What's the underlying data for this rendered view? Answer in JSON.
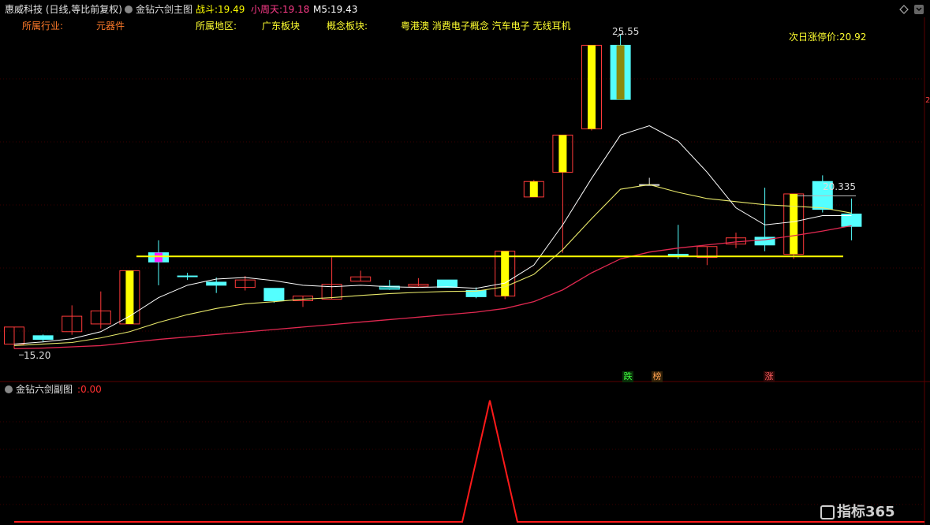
{
  "header": {
    "title": "惠威科技 (日线,等比前复权)",
    "indicator_name": "金钻六剑主图",
    "zhandou_label": "战斗:",
    "zhandou_value": "19.49",
    "xiaozhoutian_label": "小周天:",
    "xiaozhoutian_value": "19.18",
    "m5_label": "M5:",
    "m5_value": "19.43"
  },
  "info": {
    "industry_label": "所属行业:",
    "industry_value": "元器件",
    "region_label": "所属地区:",
    "region_value": "广东板块",
    "concept_label": "概念板块:",
    "concept_value": "粤港澳 消费电子概念 汽车电子 无线耳机",
    "limit_label": "次日涨停价:",
    "limit_value": "20.92"
  },
  "price_labels": {
    "high": "25.55",
    "low": "15.20",
    "right": "20.335",
    "edge_mark": "2"
  },
  "badges": {
    "down": "跌",
    "list": "榜",
    "up": "涨"
  },
  "sub_chart": {
    "title": "金钻六剑副图",
    "value_prefix": ":",
    "value": "0.00"
  },
  "watermark": {
    "brand": "指标365"
  },
  "colors": {
    "up_candle": "#ff3a3a",
    "down_candle": "#54ffff",
    "yellow": "#ffff00",
    "ma_white": "#ffffff",
    "ma_yellow": "#e8e86a",
    "ma_red": "#e02850",
    "sub_line": "#ff1a1a"
  },
  "chart_data": {
    "type": "candlestick",
    "candles": [
      {
        "o": 15.55,
        "c": 16.1,
        "h": 16.1,
        "l": 15.4,
        "style": "up"
      },
      {
        "o": 15.82,
        "c": 15.7,
        "h": 15.86,
        "l": 15.62,
        "style": "down"
      },
      {
        "o": 15.95,
        "c": 16.45,
        "h": 16.8,
        "l": 15.85,
        "style": "up"
      },
      {
        "o": 16.2,
        "c": 16.62,
        "h": 17.25,
        "l": 16.05,
        "style": "up"
      },
      {
        "o": 16.2,
        "c": 17.92,
        "h": 17.92,
        "l": 16.2,
        "style": "yellow"
      },
      {
        "o": 18.2,
        "c": 18.5,
        "h": 18.9,
        "l": 17.45,
        "style": "magenta"
      },
      {
        "o": 17.75,
        "c": 17.75,
        "h": 17.85,
        "l": 17.62,
        "style": "down"
      },
      {
        "o": 17.55,
        "c": 17.45,
        "h": 17.7,
        "l": 17.2,
        "style": "down"
      },
      {
        "o": 17.38,
        "c": 17.62,
        "h": 17.75,
        "l": 17.28,
        "style": "up"
      },
      {
        "o": 17.35,
        "c": 16.95,
        "h": 17.35,
        "l": 16.88,
        "style": "down"
      },
      {
        "o": 16.95,
        "c": 17.1,
        "h": 17.1,
        "l": 16.75,
        "style": "up"
      },
      {
        "o": 17.0,
        "c": 17.48,
        "h": 18.35,
        "l": 17.0,
        "style": "up"
      },
      {
        "o": 17.58,
        "c": 17.72,
        "h": 17.92,
        "l": 17.58,
        "style": "up"
      },
      {
        "o": 17.42,
        "c": 17.32,
        "h": 17.62,
        "l": 17.3,
        "style": "teal"
      },
      {
        "o": 17.42,
        "c": 17.48,
        "h": 17.68,
        "l": 17.42,
        "style": "up"
      },
      {
        "o": 17.62,
        "c": 17.38,
        "h": 17.62,
        "l": 17.38,
        "style": "down"
      },
      {
        "o": 17.28,
        "c": 17.08,
        "h": 17.38,
        "l": 17.03,
        "style": "down"
      },
      {
        "o": 17.1,
        "c": 18.55,
        "h": 18.55,
        "l": 17.0,
        "style": "yellow"
      },
      {
        "o": 20.3,
        "c": 20.8,
        "h": 20.85,
        "l": 20.3,
        "style": "yellow"
      },
      {
        "o": 21.1,
        "c": 22.3,
        "h": 22.3,
        "l": 18.5,
        "style": "yellow"
      },
      {
        "o": 22.5,
        "c": 25.2,
        "h": 25.2,
        "l": 22.45,
        "style": "yellow"
      },
      {
        "o": 25.2,
        "c": 23.45,
        "h": 25.55,
        "l": 23.45,
        "style": "olive"
      },
      {
        "o": 20.7,
        "c": 20.7,
        "h": 20.92,
        "l": 20.68,
        "style": "doji"
      },
      {
        "o": 18.45,
        "c": 18.38,
        "h": 19.4,
        "l": 18.3,
        "style": "down"
      },
      {
        "o": 18.35,
        "c": 18.7,
        "h": 18.7,
        "l": 18.1,
        "style": "up"
      },
      {
        "o": 18.78,
        "c": 18.98,
        "h": 19.15,
        "l": 18.65,
        "style": "up"
      },
      {
        "o": 19.0,
        "c": 18.75,
        "h": 20.6,
        "l": 18.55,
        "style": "down"
      },
      {
        "o": 18.45,
        "c": 20.4,
        "h": 20.4,
        "l": 18.3,
        "style": "yellow"
      },
      {
        "o": 20.8,
        "c": 19.9,
        "h": 21.0,
        "l": 19.8,
        "style": "down"
      },
      {
        "o": 19.75,
        "c": 19.35,
        "h": 20.25,
        "l": 18.9,
        "style": "down"
      }
    ],
    "ma_white": [
      15.55,
      15.62,
      15.72,
      15.95,
      16.45,
      17.05,
      17.45,
      17.65,
      17.7,
      17.6,
      17.45,
      17.4,
      17.45,
      17.4,
      17.38,
      17.4,
      17.35,
      17.52,
      18.1,
      19.4,
      20.9,
      22.3,
      22.6,
      22.1,
      21.1,
      19.95,
      19.4,
      19.5,
      19.7,
      19.7
    ],
    "ma_yellow": [
      15.5,
      15.55,
      15.6,
      15.75,
      15.95,
      16.25,
      16.5,
      16.7,
      16.85,
      16.92,
      17.0,
      17.05,
      17.12,
      17.18,
      17.22,
      17.25,
      17.26,
      17.4,
      17.8,
      18.6,
      19.6,
      20.55,
      20.7,
      20.45,
      20.25,
      20.15,
      20.05,
      20.0,
      19.95,
      19.78
    ],
    "ma_red": [
      15.4,
      15.42,
      15.46,
      15.5,
      15.6,
      15.7,
      15.78,
      15.86,
      15.94,
      16.02,
      16.1,
      16.18,
      16.26,
      16.34,
      16.42,
      16.5,
      16.58,
      16.7,
      16.92,
      17.3,
      17.85,
      18.3,
      18.52,
      18.65,
      18.75,
      18.85,
      18.92,
      19.05,
      19.2,
      19.37
    ],
    "h_line": 18.38,
    "right_line": 20.335,
    "y_range": [
      14.9,
      26.0
    ],
    "sub": {
      "x": [
        0,
        1,
        2,
        3,
        4
      ],
      "values": [
        0,
        0,
        1,
        0,
        0
      ]
    }
  }
}
